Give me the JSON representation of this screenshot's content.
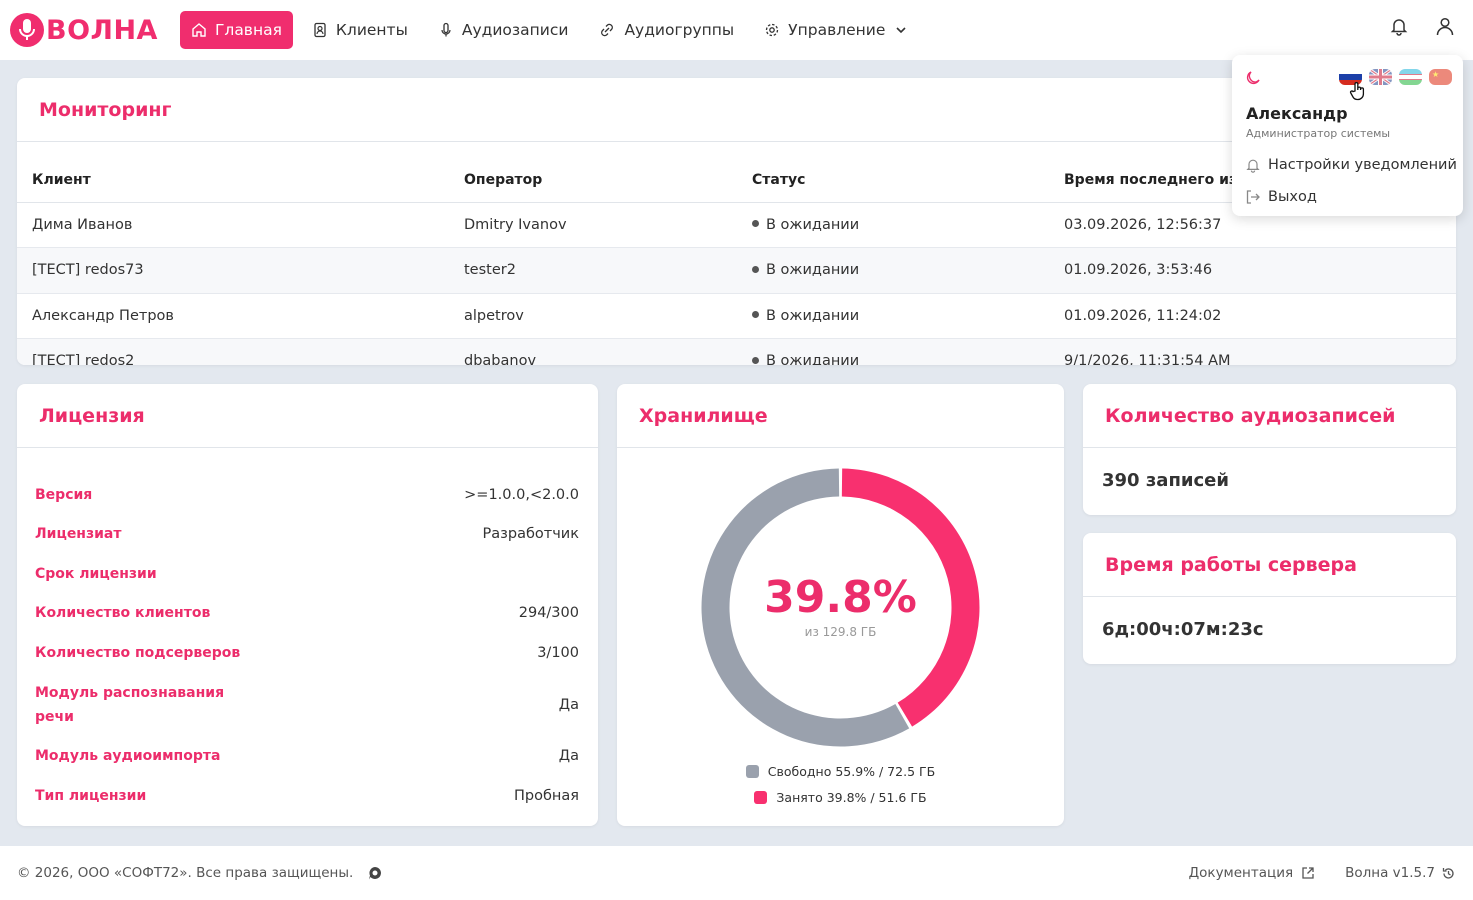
{
  "brand": {
    "name": "ВОЛНА",
    "color": "#f02d6e"
  },
  "nav": {
    "items": [
      {
        "label": "Главная",
        "icon": "home-icon",
        "active": true
      },
      {
        "label": "Клиенты",
        "icon": "contacts-icon"
      },
      {
        "label": "Аудиозаписи",
        "icon": "mic-icon"
      },
      {
        "label": "Аудиогруппы",
        "icon": "link-icon"
      },
      {
        "label": "Управление",
        "icon": "gear-icon"
      }
    ]
  },
  "monitoring": {
    "title": "Мониторинг",
    "columns": [
      "Клиент",
      "Оператор",
      "Статус",
      "Время последнего изм"
    ],
    "rows": [
      {
        "client": "Дима Иванов",
        "operator": "Dmitry Ivanov",
        "status": "В ожидании",
        "time": "03.09.2026, 12:56:37"
      },
      {
        "client": "[ТЕСТ] redos73",
        "operator": "tester2",
        "status": "В ожидании",
        "time": "01.09.2026, 3:53:46"
      },
      {
        "client": "Александр Петров",
        "operator": "alpetrov",
        "status": "В ожидании",
        "time": "01.09.2026, 11:24:02"
      },
      {
        "client": "[ТЕСТ] redos2",
        "operator": "dbabanov",
        "status": "В ожидании",
        "time": "9/1/2026, 11:31:54 AM"
      }
    ]
  },
  "license": {
    "title": "Лицензия",
    "rows": [
      {
        "key": "Версия",
        "value": ">=1.0.0,<2.0.0"
      },
      {
        "key": "Лицензиат",
        "value": "Разработчик"
      },
      {
        "key": "Срок лицензии",
        "value": ""
      },
      {
        "key": "Количество клиентов",
        "value": "294/300"
      },
      {
        "key": "Количество подсерверов",
        "value": "3/100"
      },
      {
        "key": "Модуль распознавания речи",
        "value": "Да"
      },
      {
        "key": "Модуль аудиоимпорта",
        "value": "Да"
      },
      {
        "key": "Тип лицензии",
        "value": "Пробная"
      }
    ]
  },
  "storage": {
    "title": "Хранилище",
    "center_value": "39.8%",
    "center_sub": "из 129.8 ГБ",
    "legend_free": "Свободно 55.9% / 72.5 ГБ",
    "legend_used": "Занято 39.8% / 51.6 ГБ"
  },
  "chart_data": {
    "type": "pie",
    "slices": [
      {
        "name": "Занято",
        "value": 51.6,
        "color": "#f8306f"
      },
      {
        "name": "Свободно",
        "value": 72.5,
        "color": "#9aa1ad"
      }
    ]
  },
  "records": {
    "title": "Количество аудиозаписей",
    "value": "390 записей"
  },
  "uptime": {
    "title": "Время работы сервера",
    "value": "6д:00ч:07м:23с"
  },
  "user_menu": {
    "name": "Александр",
    "role": "Администратор системы",
    "notifications": "Настройки уведомлений",
    "logout": "Выход"
  },
  "footer": {
    "copyright": "© 2026, ООО «СОФТ72». Все права защищены.",
    "docs": "Документация",
    "version": "Волна v1.5.7"
  }
}
